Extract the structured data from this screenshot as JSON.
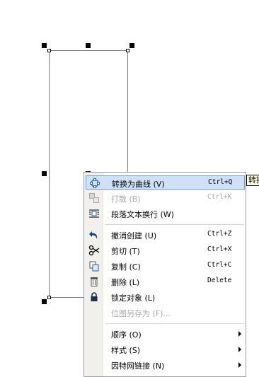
{
  "context_menu": {
    "items": [
      {
        "label": "转换为曲线 (V)",
        "shortcut": "Ctrl+Q",
        "icon": "convert-to-curves-icon",
        "enabled": true,
        "highlighted": true
      },
      {
        "label": "打散 (B)",
        "shortcut": "Ctrl+K",
        "icon": "break-apart-icon",
        "enabled": false
      },
      {
        "label": "段落文本换行 (W)",
        "shortcut": "",
        "icon": "wrap-paragraph-text-icon",
        "enabled": true
      },
      {
        "label": "撤消创建 (U)",
        "shortcut": "Ctrl+Z",
        "icon": "undo-icon",
        "enabled": true
      },
      {
        "label": "剪切 (T)",
        "shortcut": "Ctrl+X",
        "icon": "cut-icon",
        "enabled": true
      },
      {
        "label": "复制 (C)",
        "shortcut": "Ctrl+C",
        "icon": "copy-icon",
        "enabled": true
      },
      {
        "label": "删除 (L)",
        "shortcut": "Delete",
        "icon": "delete-icon",
        "enabled": true
      },
      {
        "label": "锁定对象 (L)",
        "shortcut": "",
        "icon": "lock-icon",
        "enabled": true
      },
      {
        "label": "位图另存为 (F)...",
        "shortcut": "",
        "icon": "",
        "enabled": false
      },
      {
        "label": "顺序 (O)",
        "shortcut": "",
        "icon": "",
        "enabled": true,
        "submenu": true
      },
      {
        "label": "样式 (S)",
        "shortcut": "",
        "icon": "",
        "enabled": true,
        "submenu": true
      },
      {
        "label": "因特网链接 (N)",
        "shortcut": "",
        "icon": "",
        "enabled": true,
        "submenu": true
      }
    ]
  },
  "tooltip": {
    "text": "转换"
  },
  "colors": {
    "highlight": "#cfe0f7",
    "highlight_border": "#6b9bd6",
    "disabled_text": "#a8a8a8"
  }
}
